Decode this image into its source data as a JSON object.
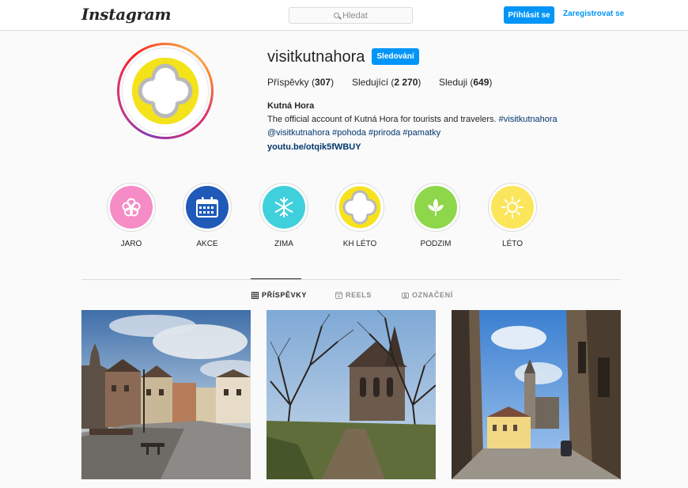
{
  "header": {
    "logo": "Instagram",
    "search_placeholder": "Hledat",
    "login_label": "Přihlásit se",
    "register_label": "Zaregistrovat se"
  },
  "profile": {
    "username": "visitkutnahora",
    "follow_label": "Sledování",
    "stats": {
      "posts_label": "Příspěvky",
      "posts_count": "307",
      "followers_label": "Sledující",
      "followers_count": "2 270",
      "following_label": "Sleduji",
      "following_count": "649"
    },
    "bio_name": "Kutná Hora",
    "bio_text": "The official account of Kutná Hora for tourists and travelers.",
    "bio_tags_line1": "#visitkutnahora",
    "bio_tags_line2_1": "@visitkutnahora",
    "bio_tags_line2_2": "#pohoda",
    "bio_tags_line2_3": "#priroda",
    "bio_tags_line2_4": "#pamatky",
    "link": "youtu.be/otqik5fWBUY"
  },
  "highlights": [
    {
      "label": "JARO",
      "icon": "flower-icon",
      "color": "#f58cc6"
    },
    {
      "label": "AKCE",
      "icon": "calendar-icon",
      "color": "#1f5ab8"
    },
    {
      "label": "ZIMA",
      "icon": "snowflake-icon",
      "color": "#3fd0dc"
    },
    {
      "label": "KH LÉTO",
      "icon": "kutna-hora-logo-icon",
      "color": "#f7e21e"
    },
    {
      "label": "PODZIM",
      "icon": "leaves-icon",
      "color": "#8ed64a"
    },
    {
      "label": "LÉTO",
      "icon": "sun-icon",
      "color": "#fbe55a"
    }
  ],
  "tabs": [
    {
      "label": "PŘÍSPĚVKY",
      "icon": "grid-icon",
      "active": true
    },
    {
      "label": "REELS",
      "icon": "reels-icon",
      "active": false
    },
    {
      "label": "OZNAČENÍ",
      "icon": "tagged-icon",
      "active": false
    }
  ],
  "colors": {
    "accent": "#0095f6",
    "link": "#00376b"
  }
}
